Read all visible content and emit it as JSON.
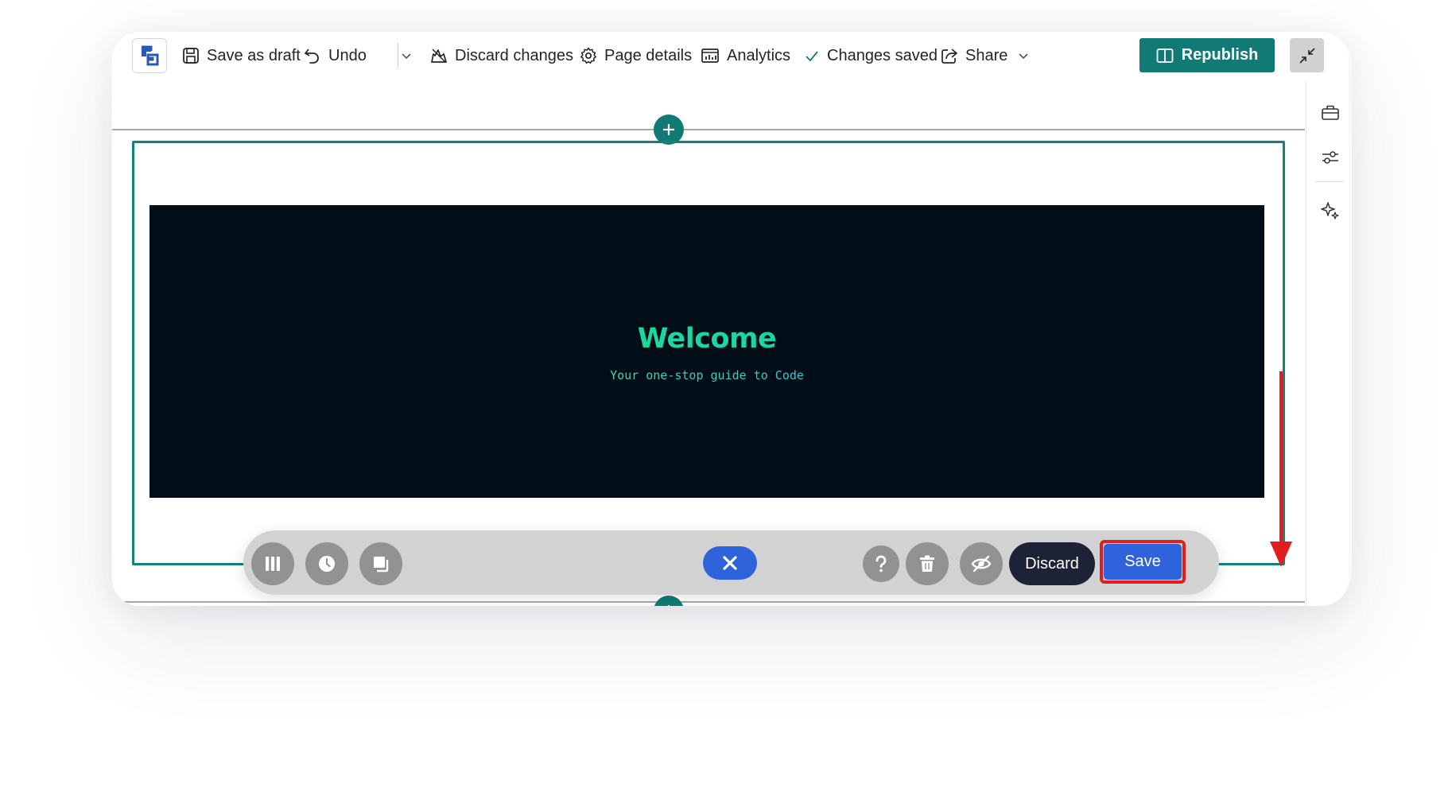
{
  "toolbar": {
    "save_draft_label": "Save as draft",
    "undo_label": "Undo",
    "discard_changes_label": "Discard changes",
    "page_details_label": "Page details",
    "analytics_label": "Analytics",
    "changes_saved_label": "Changes saved",
    "share_label": "Share",
    "republish_label": "Republish"
  },
  "hero": {
    "title": "Welcome",
    "subtitle": "Your one-stop guide to Code"
  },
  "edit_bar": {
    "discard_label": "Discard",
    "save_label": "Save"
  },
  "icons": {
    "logo": "app-logo-icon",
    "save_draft": "floppy-disk-icon",
    "undo": "undo-arrow-icon",
    "undo_dropdown": "chevron-down-icon",
    "discard": "discard-icon",
    "page_details": "gear-icon",
    "analytics": "analytics-icon",
    "changes_saved": "checkmark-icon",
    "share": "share-icon",
    "republish": "book-open-icon",
    "collapse": "collapse-arrows-icon",
    "toolbox": "toolbox-icon",
    "sliders": "sliders-icon",
    "sparkle": "sparkle-icon",
    "columns": "columns-icon",
    "history": "clock-icon",
    "duplicate": "duplicate-icon",
    "close": "close-icon",
    "help": "question-mark-icon",
    "delete": "trash-icon",
    "hide": "eye-off-icon"
  },
  "colors": {
    "accent": "#117a75",
    "primary_blue": "#2f63dc",
    "hero_background": "#020e17",
    "annotation_red": "#e01e1e",
    "discard_dark": "#1e2236"
  }
}
